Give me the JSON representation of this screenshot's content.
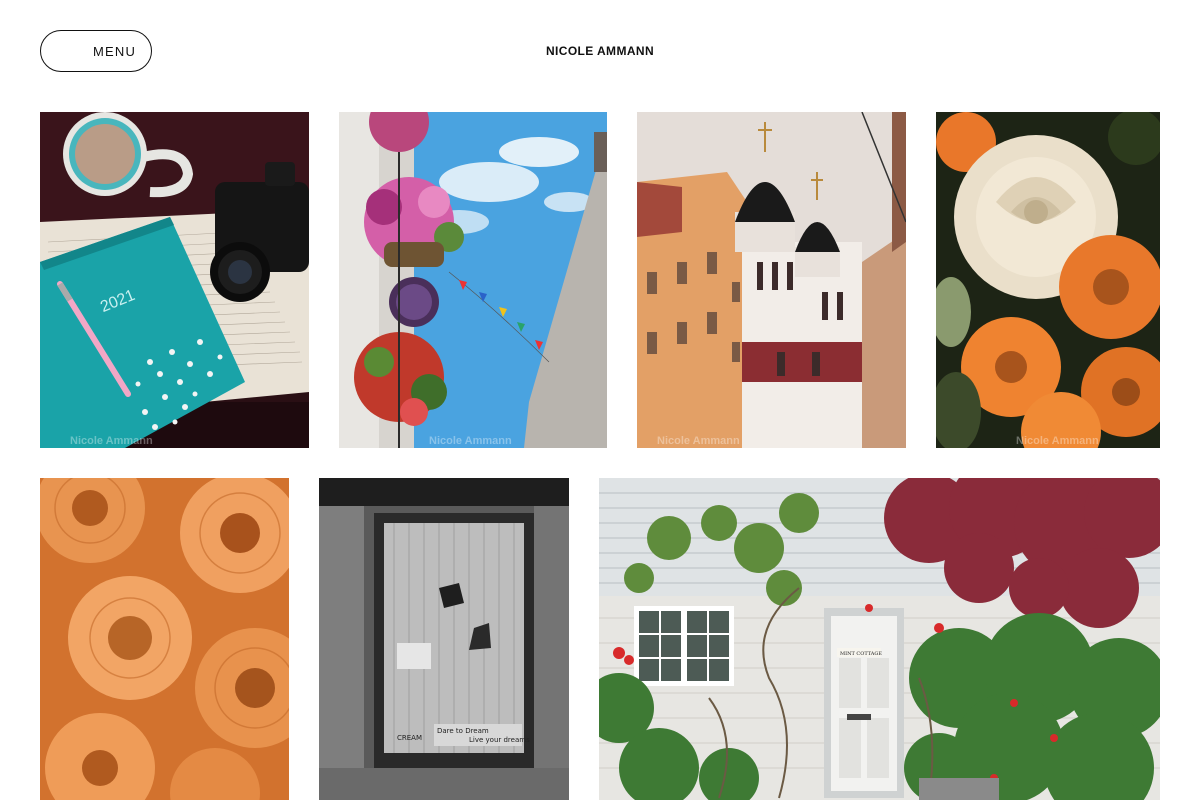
{
  "header": {
    "menu_label": "MENU",
    "site_title": "NICOLE AMMANN"
  },
  "gallery": {
    "watermark": "Nicole Ammann",
    "diary_cover_text": "2021",
    "window_sign_1": "Dare to Dream",
    "window_sign_2": "Live your dreams",
    "window_sign_3": "CREAM",
    "cottage_sign": "MINT COTTAGE",
    "items": [
      {
        "subject": "coffee-camera-diary"
      },
      {
        "subject": "hanging-flower-baskets-sky"
      },
      {
        "subject": "orthodox-cathedral-street"
      },
      {
        "subject": "rose-chrysanthemum-bouquet"
      },
      {
        "subject": "orange-chrysanthemums"
      },
      {
        "subject": "lace-curtain-window"
      },
      {
        "subject": "mint-cottage-door"
      }
    ]
  },
  "colors": {
    "text": "#111111",
    "background": "#ffffff"
  }
}
